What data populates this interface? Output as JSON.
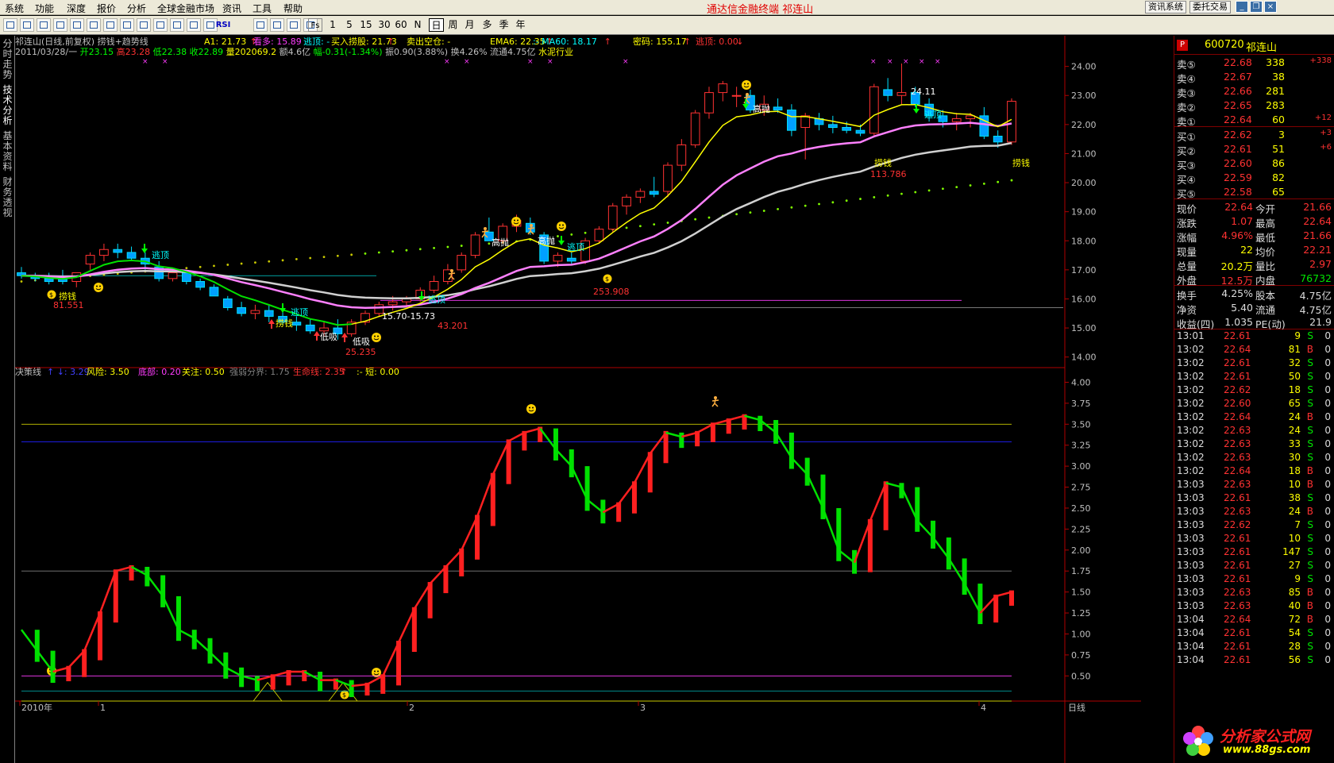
{
  "menu": {
    "items": [
      "系统",
      "功能",
      "深度",
      "报价",
      "分析",
      "全球金融市场",
      "资讯",
      "工具",
      "帮助"
    ],
    "center_title": "通达信金融终端  祁连山",
    "right_buttons": [
      "资讯系统",
      "委托交易"
    ]
  },
  "toolbar": {
    "periods": [
      "1",
      "5",
      "15",
      "30",
      "60",
      "N",
      "日",
      "周",
      "月",
      "多",
      "季",
      "年"
    ],
    "selected_period": "日",
    "rsi_label": "RSI",
    "fs_label": "Fs"
  },
  "leftnav": [
    "分时走势",
    "技术分析",
    "基本资料",
    "财务透视"
  ],
  "upper": {
    "title": "祁连山(日线,前复权) 捞钱+趋势线",
    "indicators": [
      {
        "label": "A1: 21.73",
        "arrow": "↑",
        "color": "#ffff00"
      },
      {
        "label": "看多: 15.89",
        "color": "#ff3cff"
      },
      {
        "label": "逃顶: -",
        "color": "#00ffff"
      },
      {
        "label": "买入捞股: 21.73",
        "arrow": "↑",
        "color": "#ffff00"
      },
      {
        "label": "卖出空仓: -",
        "color": "#ffff00"
      },
      {
        "label": "EMA6: 22.35",
        "arrow": "↑",
        "color": "#ffff00"
      },
      {
        "label": ":- MA60: 18.17",
        "arrow": "↑",
        "color": "#00ffff"
      },
      {
        "label": "密码: 155.17",
        "arrow": "↑",
        "color": "#ffff00"
      },
      {
        "label": "逃顶: 0.00",
        "arrow": "↓",
        "color": "#ff3232"
      }
    ],
    "ohlc_line": [
      {
        "t": "2011/03/28/一 ",
        "c": "#c0c0c0"
      },
      {
        "t": "开23.15 ",
        "c": "#00ff00"
      },
      {
        "t": "高23.28 ",
        "c": "#ff3232"
      },
      {
        "t": "低22.38 ",
        "c": "#00ff00"
      },
      {
        "t": "收22.89 ",
        "c": "#00ff00"
      },
      {
        "t": "量202069.2 ",
        "c": "#ffff00"
      },
      {
        "t": "额4.6亿 ",
        "c": "#c0c0c0"
      },
      {
        "t": "幅-0.31(-1.34%) ",
        "c": "#00ff00"
      },
      {
        "t": "振0.90(3.88%) ",
        "c": "#c0c0c0"
      },
      {
        "t": "换4.26% ",
        "c": "#c0c0c0"
      },
      {
        "t": "流通4.75亿 ",
        "c": "#c0c0c0"
      },
      {
        "t": "水泥行业",
        "c": "#ffff00"
      }
    ],
    "yaxis": [
      "24.00",
      "23.00",
      "22.00",
      "21.00",
      "20.00",
      "19.00",
      "18.00",
      "17.00",
      "16.00",
      "15.00",
      "14.00"
    ],
    "ymin": 13.8,
    "ymax": 24.4,
    "annotations": {
      "peak": "24.11",
      "range": "15.70-15.73",
      "low1": "81.551",
      "low2": "25.235",
      "low3": "43.201",
      "mid": "253.908",
      "high": "113.786",
      "cn_sell": "高抛",
      "cn_top": "逃顶",
      "cn_money": "捞钱",
      "cn_low": "低吸"
    }
  },
  "lower": {
    "title": "决策线",
    "indicators": [
      {
        "label": "↑ ↓: 3.29",
        "color": "#4040ff"
      },
      {
        "label": "风险: 3.50",
        "color": "#ffff00"
      },
      {
        "label": "底部: 0.20",
        "color": "#ff3cff"
      },
      {
        "label": "关注: 0.50",
        "color": "#ffff00"
      },
      {
        "label": "强弱分界: 1.75",
        "color": "#808080"
      },
      {
        "label": "生命线: 2.35",
        "arrow": "↑",
        "color": "#ff3232"
      },
      {
        "label": ":- 短: 0.00",
        "color": "#ffff00"
      }
    ],
    "yaxis": [
      "4.00",
      "3.75",
      "3.50",
      "3.25",
      "3.00",
      "2.75",
      "2.50",
      "2.25",
      "2.00",
      "1.75",
      "1.50",
      "1.25",
      "1.00",
      "0.75",
      "0.50"
    ],
    "ymin": 0.2,
    "ymax": 4.08
  },
  "xaxis": {
    "labels": [
      "2010年",
      "1",
      "2",
      "3",
      "4"
    ],
    "right": "日线"
  },
  "chart_data": {
    "type": "candlestick",
    "candles": [
      [
        16.9,
        17.1,
        16.7,
        16.8
      ],
      [
        16.8,
        16.9,
        16.6,
        16.7
      ],
      [
        16.7,
        16.9,
        16.5,
        16.6
      ],
      [
        16.7,
        17.0,
        16.5,
        16.6
      ],
      [
        16.6,
        16.8,
        16.4,
        16.9
      ],
      [
        17.2,
        17.6,
        17.0,
        17.5
      ],
      [
        17.5,
        17.9,
        17.3,
        17.7
      ],
      [
        17.7,
        17.9,
        17.4,
        17.6
      ],
      [
        17.6,
        17.8,
        17.3,
        17.4
      ],
      [
        17.4,
        17.6,
        17.0,
        17.2
      ],
      [
        17.1,
        17.3,
        16.6,
        16.7
      ],
      [
        16.7,
        17.0,
        16.6,
        16.9
      ],
      [
        16.9,
        17.0,
        16.5,
        16.6
      ],
      [
        16.6,
        16.7,
        16.3,
        16.4
      ],
      [
        16.4,
        16.5,
        16.1,
        16.1
      ],
      [
        16.0,
        16.1,
        15.6,
        15.7
      ],
      [
        15.7,
        15.9,
        15.4,
        15.5
      ],
      [
        15.5,
        15.8,
        15.3,
        15.6
      ],
      [
        15.6,
        15.8,
        15.2,
        15.4
      ],
      [
        15.4,
        15.6,
        15.1,
        15.2
      ],
      [
        15.2,
        15.4,
        14.9,
        15.1
      ],
      [
        15.1,
        15.3,
        14.8,
        14.9
      ],
      [
        14.9,
        15.2,
        14.7,
        15.0
      ],
      [
        15.0,
        15.3,
        14.6,
        14.8
      ],
      [
        14.8,
        15.3,
        14.7,
        15.2
      ],
      [
        15.2,
        15.6,
        15.1,
        15.5
      ],
      [
        15.5,
        15.9,
        15.4,
        15.8
      ],
      [
        15.8,
        16.1,
        15.6,
        15.9
      ],
      [
        15.9,
        16.1,
        15.7,
        16.0
      ],
      [
        16.0,
        16.4,
        15.9,
        16.3
      ],
      [
        16.3,
        16.8,
        16.2,
        16.6
      ],
      [
        16.6,
        17.2,
        16.5,
        17.0
      ],
      [
        17.0,
        17.6,
        16.9,
        17.5
      ],
      [
        17.5,
        18.3,
        17.4,
        18.2
      ],
      [
        18.3,
        18.8,
        18.1,
        18.0
      ],
      [
        18.0,
        18.6,
        17.9,
        18.5
      ],
      [
        18.5,
        18.9,
        18.3,
        18.7
      ],
      [
        18.6,
        18.8,
        18.2,
        18.3
      ],
      [
        18.2,
        18.3,
        17.2,
        17.3
      ],
      [
        17.3,
        17.6,
        17.1,
        17.5
      ],
      [
        17.4,
        17.6,
        17.2,
        17.3
      ],
      [
        17.3,
        18.1,
        17.2,
        18.0
      ],
      [
        18.0,
        18.5,
        17.9,
        18.4
      ],
      [
        18.4,
        19.3,
        18.3,
        19.2
      ],
      [
        19.2,
        19.6,
        18.9,
        19.5
      ],
      [
        19.5,
        19.8,
        19.3,
        19.7
      ],
      [
        19.7,
        20.2,
        19.5,
        19.6
      ],
      [
        19.7,
        20.7,
        19.5,
        20.6
      ],
      [
        20.6,
        21.5,
        20.4,
        21.3
      ],
      [
        21.3,
        22.5,
        21.2,
        22.4
      ],
      [
        22.4,
        23.3,
        22.2,
        23.1
      ],
      [
        23.1,
        23.5,
        22.8,
        23.4
      ],
      [
        23.0,
        23.3,
        22.6,
        23.0
      ],
      [
        23.0,
        23.2,
        22.4,
        22.5
      ],
      [
        22.5,
        23.0,
        22.3,
        22.7
      ],
      [
        22.6,
        22.9,
        22.4,
        22.5
      ],
      [
        22.5,
        22.7,
        21.6,
        21.8
      ],
      [
        21.9,
        22.4,
        20.8,
        22.3
      ],
      [
        22.2,
        22.4,
        21.8,
        22.0
      ],
      [
        22.0,
        22.3,
        21.7,
        21.9
      ],
      [
        21.9,
        22.1,
        21.7,
        21.8
      ],
      [
        21.8,
        22.0,
        21.6,
        21.7
      ],
      [
        21.7,
        23.4,
        21.6,
        23.3
      ],
      [
        23.2,
        23.6,
        22.8,
        23.0
      ],
      [
        23.0,
        24.1,
        22.7,
        23.1
      ],
      [
        23.1,
        23.3,
        22.6,
        22.7
      ],
      [
        22.7,
        22.9,
        22.1,
        22.3
      ],
      [
        22.3,
        22.5,
        21.9,
        22.1
      ],
      [
        22.1,
        22.4,
        21.8,
        22.2
      ],
      [
        22.2,
        22.4,
        21.9,
        22.3
      ],
      [
        22.3,
        22.6,
        21.5,
        21.6
      ],
      [
        21.6,
        21.8,
        21.2,
        21.4
      ],
      [
        21.4,
        22.9,
        21.3,
        22.8
      ]
    ],
    "decision_line": [
      1.05,
      0.8,
      0.55,
      0.6,
      0.8,
      1.25,
      1.75,
      1.8,
      1.7,
      1.45,
      1.05,
      0.95,
      0.78,
      0.6,
      0.5,
      0.45,
      0.5,
      0.55,
      0.55,
      0.45,
      0.45,
      0.38,
      0.4,
      0.5,
      0.9,
      1.3,
      1.6,
      1.8,
      2.0,
      2.4,
      2.9,
      3.3,
      3.4,
      3.45,
      3.2,
      3.0,
      2.6,
      2.45,
      2.55,
      2.8,
      3.15,
      3.4,
      3.35,
      3.4,
      3.5,
      3.55,
      3.6,
      3.55,
      3.4,
      3.1,
      2.9,
      2.5,
      2.0,
      1.85,
      2.35,
      2.8,
      2.75,
      2.35,
      2.15,
      1.9,
      1.6,
      1.25,
      1.45,
      1.5
    ]
  },
  "quote": {
    "code": "600720",
    "name": "祁连山",
    "badge": "P",
    "asks": [
      {
        "label": "卖⑤",
        "price": "22.68",
        "vol": "338",
        "chg": "+338"
      },
      {
        "label": "卖④",
        "price": "22.67",
        "vol": "38",
        "chg": ""
      },
      {
        "label": "卖③",
        "price": "22.66",
        "vol": "281",
        "chg": ""
      },
      {
        "label": "卖②",
        "price": "22.65",
        "vol": "283",
        "chg": ""
      },
      {
        "label": "卖①",
        "price": "22.64",
        "vol": "60",
        "chg": "+12"
      }
    ],
    "bids": [
      {
        "label": "买①",
        "price": "22.62",
        "vol": "3",
        "chg": "+3"
      },
      {
        "label": "买②",
        "price": "22.61",
        "vol": "51",
        "chg": "+6"
      },
      {
        "label": "买③",
        "price": "22.60",
        "vol": "86",
        "chg": ""
      },
      {
        "label": "买④",
        "price": "22.59",
        "vol": "82",
        "chg": ""
      },
      {
        "label": "买⑤",
        "price": "22.58",
        "vol": "65",
        "chg": ""
      }
    ],
    "stats1": [
      {
        "l": "现价",
        "v": "22.64",
        "l2": "今开",
        "v2": "21.66"
      },
      {
        "l": "涨跌",
        "v": "1.07",
        "l2": "最高",
        "v2": "22.64"
      },
      {
        "l": "涨幅",
        "v": "4.96%",
        "l2": "最低",
        "v2": "21.66"
      },
      {
        "l": "现量",
        "v": "22",
        "l2": "均价",
        "v2": "22.21"
      },
      {
        "l": "总量",
        "v": "20.2万",
        "l2": "量比",
        "v2": "2.97"
      },
      {
        "l": "外盘",
        "v": "12.5万",
        "l2": "内盘",
        "v2": "76732"
      }
    ],
    "stats2": [
      {
        "l": "换手",
        "v": "4.25%",
        "l2": "股本",
        "v2": "4.75亿"
      },
      {
        "l": "净资",
        "v": "5.40",
        "l2": "流通",
        "v2": "4.75亿"
      },
      {
        "l": "收益(四)",
        "v": "1.035",
        "l2": "PE(动)",
        "v2": "21.9"
      }
    ],
    "ticks": [
      [
        "13:01",
        "22.61",
        "9",
        "S",
        "0"
      ],
      [
        "13:02",
        "22.64",
        "81",
        "B",
        "0"
      ],
      [
        "13:02",
        "22.61",
        "32",
        "S",
        "0"
      ],
      [
        "13:02",
        "22.61",
        "50",
        "S",
        "0"
      ],
      [
        "13:02",
        "22.62",
        "18",
        "S",
        "0"
      ],
      [
        "13:02",
        "22.60",
        "65",
        "S",
        "0"
      ],
      [
        "13:02",
        "22.64",
        "24",
        "B",
        "0"
      ],
      [
        "13:02",
        "22.63",
        "24",
        "S",
        "0"
      ],
      [
        "13:02",
        "22.63",
        "33",
        "S",
        "0"
      ],
      [
        "13:02",
        "22.63",
        "30",
        "S",
        "0"
      ],
      [
        "13:02",
        "22.64",
        "18",
        "B",
        "0"
      ],
      [
        "13:03",
        "22.63",
        "10",
        "B",
        "0"
      ],
      [
        "13:03",
        "22.61",
        "38",
        "S",
        "0"
      ],
      [
        "13:03",
        "22.63",
        "24",
        "B",
        "0"
      ],
      [
        "13:03",
        "22.62",
        "7",
        "S",
        "0"
      ],
      [
        "13:03",
        "22.61",
        "10",
        "S",
        "0"
      ],
      [
        "13:03",
        "22.61",
        "147",
        "S",
        "0"
      ],
      [
        "13:03",
        "22.61",
        "27",
        "S",
        "0"
      ],
      [
        "13:03",
        "22.61",
        "9",
        "S",
        "0"
      ],
      [
        "13:03",
        "22.63",
        "85",
        "B",
        "0"
      ],
      [
        "13:03",
        "22.63",
        "40",
        "B",
        "0"
      ],
      [
        "13:04",
        "22.64",
        "72",
        "B",
        "0"
      ],
      [
        "13:04",
        "22.61",
        "54",
        "S",
        "0"
      ],
      [
        "13:04",
        "22.61",
        "28",
        "S",
        "0"
      ],
      [
        "13:04",
        "22.61",
        "56",
        "S",
        "0"
      ]
    ],
    "logo_cn": "分析家公式网",
    "logo_url": "www.88gs.com"
  }
}
